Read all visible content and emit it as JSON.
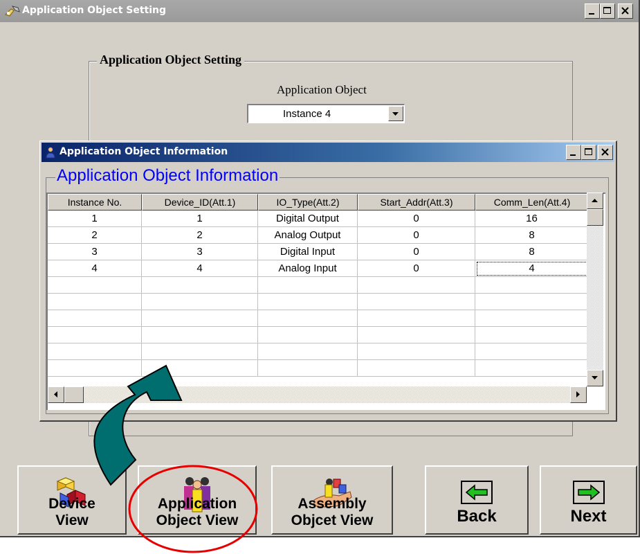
{
  "window": {
    "title": "Application Object Setting"
  },
  "setting": {
    "group_title": "Application Object Setting",
    "field_label": "Application Object",
    "selected_instance": "Instance  4"
  },
  "info_window": {
    "title": "Application Object Information",
    "group_title": "Application Object Information"
  },
  "table": {
    "columns": [
      "Instance No.",
      "Device_ID(Att.1)",
      "IO_Type(Att.2)",
      "Start_Addr(Att.3)",
      "Comm_Len(Att.4)"
    ],
    "rows": [
      [
        "1",
        "1",
        "Digital Output",
        "0",
        "16"
      ],
      [
        "2",
        "2",
        "Analog  Output",
        "0",
        "8"
      ],
      [
        "3",
        "3",
        "Digital Input",
        "0",
        "8"
      ],
      [
        "4",
        "4",
        "Analog  Input",
        "0",
        "4"
      ]
    ]
  },
  "buttons": {
    "device_view": [
      "Device",
      "View"
    ],
    "application_object_view": [
      "Application",
      "Object View"
    ],
    "assembly_object_view": [
      "Assembly",
      "Objcet View"
    ],
    "back": "Back",
    "next": "Next"
  },
  "colors": {
    "highlight_circle": "#e60000",
    "annotation_arrow": "#006e6e",
    "group_title_blue": "#0000ff"
  },
  "icons": {
    "window": "settings-hand-icon",
    "info_window": "info-user-icon",
    "device_view": "cubes-icon",
    "application_object_view": "people-group-icon",
    "assembly_object_view": "hand-with-figures-icon",
    "back": "green-left-arrow-icon",
    "next": "green-right-arrow-icon"
  }
}
